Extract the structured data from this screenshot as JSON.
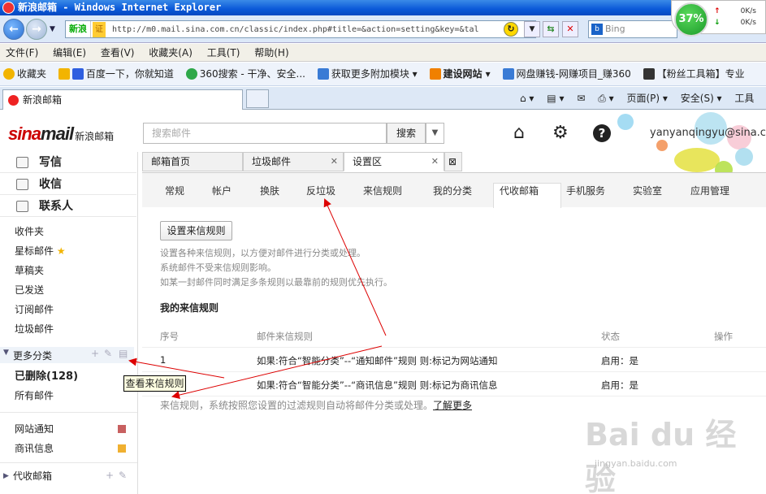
{
  "browser": {
    "title": "新浪邮箱 - Windows Internet Explorer",
    "address_zone": "新浪",
    "address_cert": "证",
    "url": "http://m0.mail.sina.com.cn/classic/index.php#title=&action=setting&key=&tal",
    "search_placeholder": "Bing",
    "search_engine_badge": "b",
    "speed_percent": "37%",
    "speed_up": "0K/s",
    "speed_down": "0K/s",
    "menu": [
      "文件(F)",
      "编辑(E)",
      "查看(V)",
      "收藏夹(A)",
      "工具(T)",
      "帮助(H)"
    ],
    "favorites": [
      {
        "label": "收藏夹",
        "color": "#f2b400"
      },
      {
        "label": "百度一下，你就知道",
        "color": "#2f5fe0"
      },
      {
        "label": "360搜索 - 干净、安全...",
        "color": "#2ea84a"
      },
      {
        "label": "获取更多附加模块 ▾",
        "color": "#3a7bd5"
      },
      {
        "label": "建设网站 ▾",
        "color": "#f08000"
      },
      {
        "label": "网盘赚钱-网赚项目_赚360",
        "color": "#3a7bd5"
      },
      {
        "label": "【粉丝工具箱】专业",
        "color": "#333333"
      }
    ],
    "tab_label": "新浪邮箱",
    "tab_tools": [
      "⌂ ▾",
      "▤ ▾",
      "✉",
      "⎙ ▾",
      "页面(P) ▾",
      "安全(S) ▾",
      "工具"
    ]
  },
  "mail": {
    "logo_main": "mail",
    "logo_prefix": "sina",
    "logo_sub": "新浪邮箱",
    "search_placeholder": "搜索邮件",
    "search_button": "搜索",
    "user_email": "yanyanqingyu@sina.cn",
    "sidebar": {
      "compose": "写信",
      "receive": "收信",
      "contacts": "联系人",
      "folders": [
        "收件夹",
        "星标邮件",
        "草稿夹",
        "已发送",
        "订阅邮件",
        "垃圾邮件"
      ],
      "more_categories": "更多分类",
      "deleted": "已删除(128)",
      "all_mail": "所有邮件",
      "labels": [
        {
          "label": "网站通知",
          "color": "#c86060"
        },
        {
          "label": "商讯信息",
          "color": "#f0b030"
        }
      ],
      "collect_mail": "代收邮箱"
    },
    "tabs": [
      "邮箱首页",
      "垃圾邮件",
      "设置区"
    ],
    "subtabs": [
      "常规",
      "帐户",
      "换肤",
      "反垃圾",
      "来信规则",
      "我的分类",
      "代收邮箱",
      "手机服务",
      "实验室",
      "应用管理"
    ],
    "set_rule_button": "设置来信规则",
    "desc_lines": [
      "设置各种来信规则，以方便对邮件进行分类或处理。",
      "系统邮件不受来信规则影响。",
      "如某一封邮件同时满足多条规则以最靠前的规则优先执行。"
    ],
    "my_rules_title": "我的来信规则",
    "table": {
      "headers": [
        "序号",
        "邮件来信规则",
        "状态",
        "操作"
      ],
      "rows": [
        {
          "no": "1",
          "rule": "如果:符合“智能分类”--“通知邮件”规则 则:标记为网站通知",
          "status": "启用：是"
        },
        {
          "no": "",
          "rule": "如果:符合“智能分类”--“商讯信息”规则 则:标记为商讯信息",
          "status": "启用：是"
        }
      ]
    },
    "footnote": "来信规则，系统按照您设置的过滤规则自动将邮件分类或处理。",
    "learn_more": "了解更多",
    "tooltip": "查看来信规则"
  },
  "watermark": {
    "main": "Bai du 经验",
    "sub": "jingyan.baidu.com"
  }
}
